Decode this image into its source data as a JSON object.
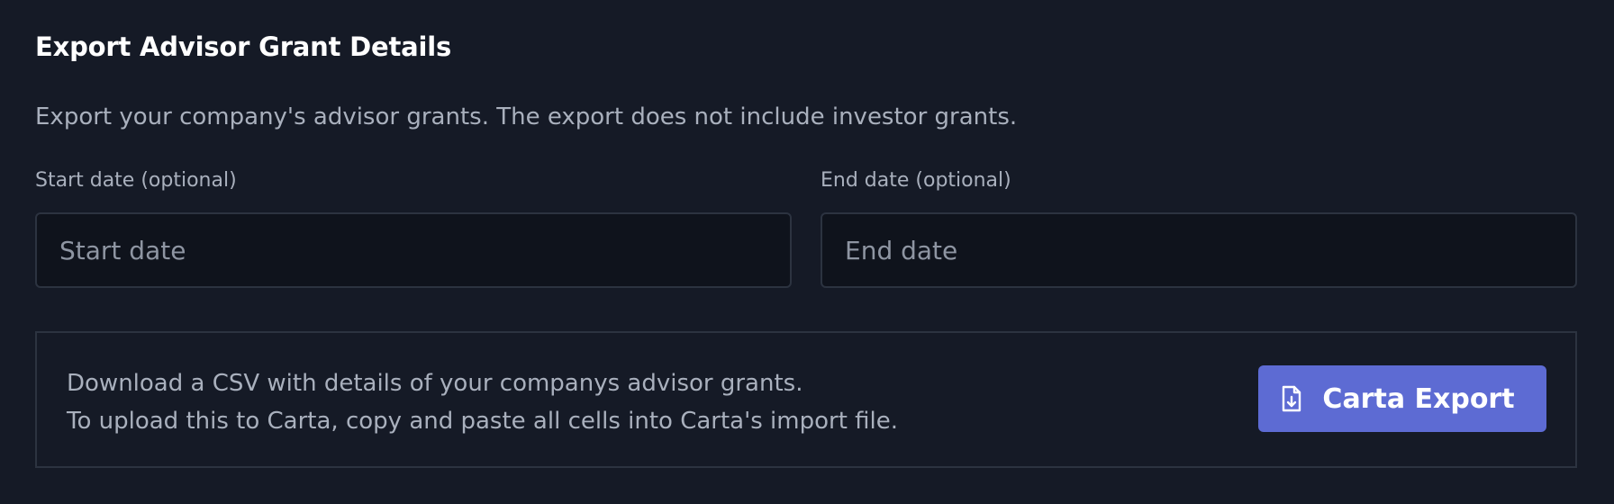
{
  "section": {
    "title": "Export Advisor Grant Details",
    "description": "Export your company's advisor grants. The export does not include investor grants."
  },
  "start_date": {
    "label": "Start date (optional)",
    "placeholder": "Start date",
    "value": ""
  },
  "end_date": {
    "label": "End date (optional)",
    "placeholder": "End date",
    "value": ""
  },
  "export_panel": {
    "line1": "Download a CSV with details of your companys advisor grants.",
    "line2": "To upload this to Carta, copy and paste all cells into Carta's import file.",
    "button_label": "Carta Export",
    "button_icon": "file-download-icon",
    "button_color": "#5d6bd3"
  }
}
